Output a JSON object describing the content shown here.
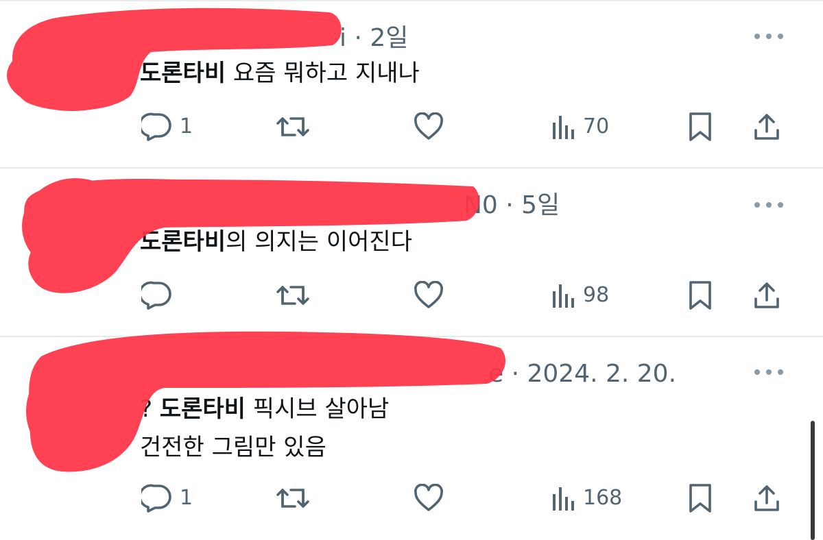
{
  "posts": [
    {
      "meta": "i · 2일",
      "lines": [
        {
          "prefix": "",
          "mention": "도론타비",
          "text": " 요즘 뭐하고 지내나"
        }
      ],
      "actions": {
        "reply_count": "1",
        "repost_count": "",
        "like_count": "",
        "view_count": "70"
      }
    },
    {
      "meta": "N0 · 5일",
      "lines": [
        {
          "prefix": "",
          "mention": "도론타비",
          "text": "의 의지는 이어진다"
        }
      ],
      "actions": {
        "reply_count": "",
        "repost_count": "",
        "like_count": "",
        "view_count": "98"
      }
    },
    {
      "meta": "e · 2024. 2. 20.",
      "lines": [
        {
          "prefix": "? ",
          "mention": "도론타비",
          "text": " 픽시브 살아남"
        },
        {
          "prefix": "",
          "mention": "",
          "text": "건전한 그림만 있음"
        }
      ],
      "actions": {
        "reply_count": "1",
        "repost_count": "",
        "like_count": "",
        "view_count": "168"
      }
    }
  ],
  "icons": {
    "reply": "speech-bubble-icon",
    "repost": "repost-arrows-icon",
    "like": "heart-icon",
    "views": "bar-chart-icon",
    "bookmark": "bookmark-icon",
    "share": "share-upload-icon",
    "more": "three-dots-icon"
  },
  "colors": {
    "icon_gray": "#536471",
    "divider": "#e7e9ec",
    "redaction_red": "#ff3446"
  }
}
